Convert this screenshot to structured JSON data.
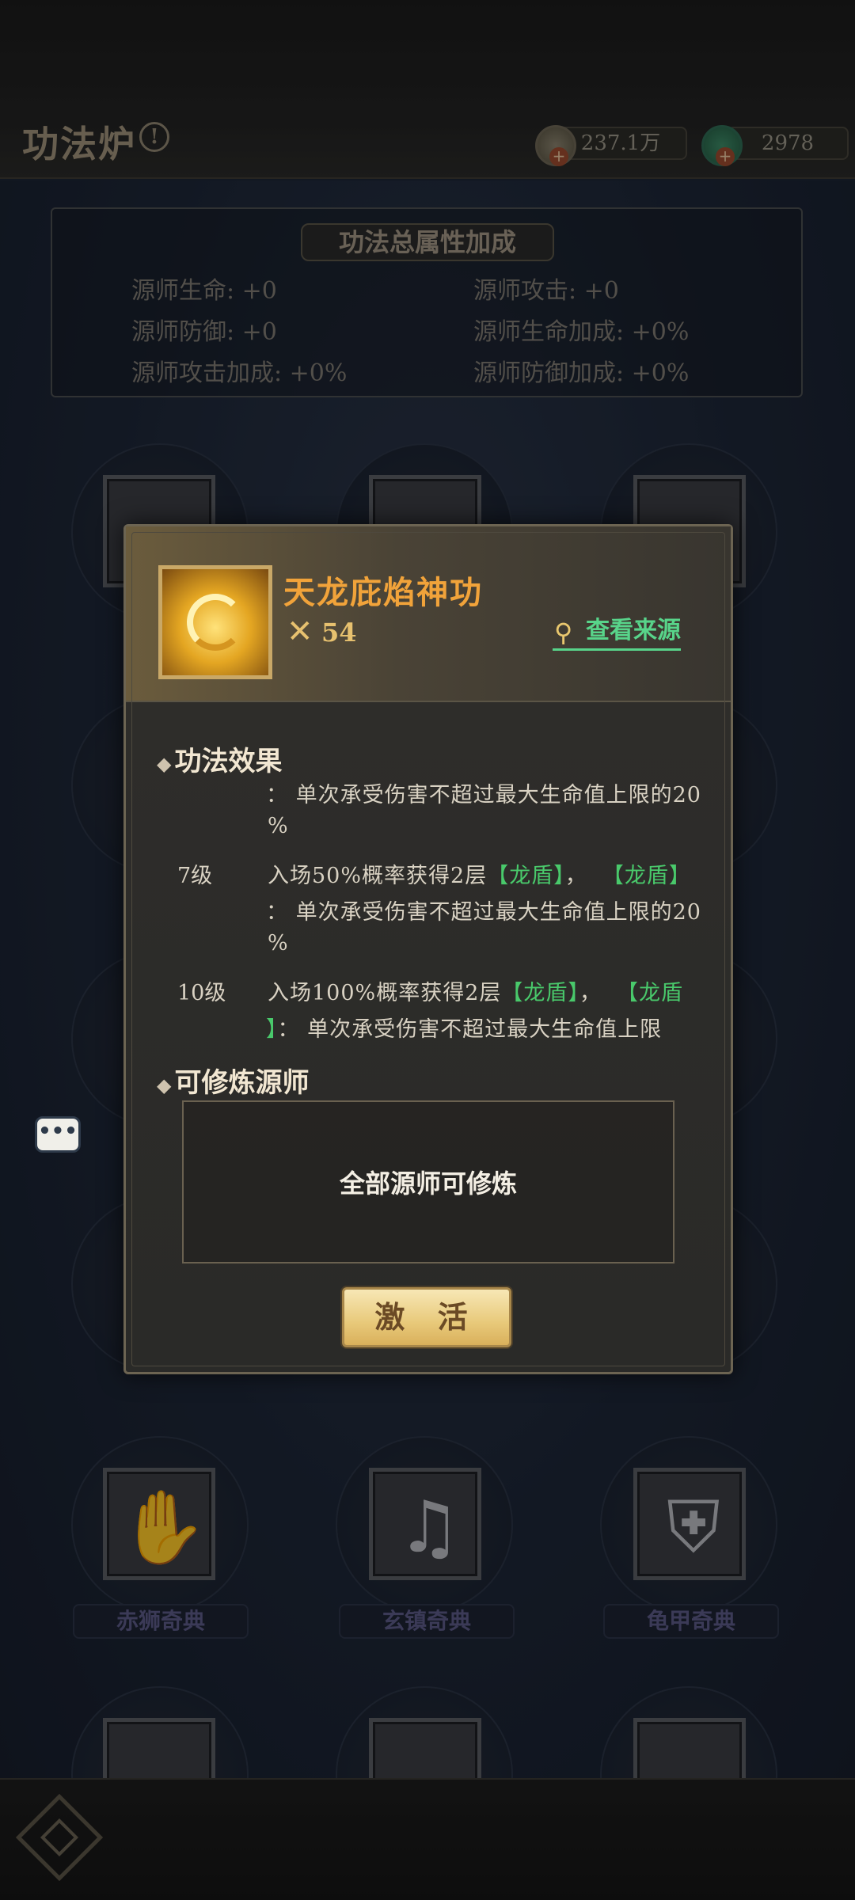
{
  "header": {
    "title": "功法炉",
    "info_icon": "!",
    "currency_coin": "237.1万",
    "currency_jade": "2978"
  },
  "stats": {
    "title": "功法总属性加成",
    "items": [
      "源师生命: +0",
      "源师攻击: +0",
      "源师防御: +0",
      "源师生命加成: +0%",
      "源师攻击加成: +0%",
      "源师防御加成: +0%"
    ]
  },
  "skills_grid": {
    "row_a": [
      "赤狮奇典",
      "玄镇奇典",
      "龟甲奇典"
    ]
  },
  "modal": {
    "skill_name": "天龙庇焰神功",
    "level": "54",
    "view_source": "查看来源",
    "effect_title": "功法效果",
    "effect_lines": {
      "l1": "： 单次承受伤害不超过最大生命值上限的20",
      "l2": "%",
      "lv7_tag": "7级",
      "lv7_a1": "入场50%概率获得2层",
      "lv7_a2": "【龙盾】",
      "lv7_a3": "，",
      "lv7_a4": "【龙盾】",
      "lv7_b": "： 单次承受伤害不超过最大生命值上限的20",
      "lv7_c": "%",
      "lv10_tag": "10级",
      "lv10_a1": "入场100%概率获得2层",
      "lv10_a2": "【龙盾】",
      "lv10_a3": "，",
      "lv10_a4": "【龙盾",
      "lv10_b1": "】",
      "lv10_b2": "： 单次承受伤害不超过最大生命值上限"
    },
    "cultivators_title": "可修炼源师",
    "cultivators_text": "全部源师可修炼",
    "activate_label": "激 活"
  },
  "icons": {
    "info": "info-icon",
    "coin": "coin-icon",
    "jade": "jade-icon",
    "level": "crossed-swords-icon",
    "search": "magnifier-icon",
    "chat": "chat-bubble-icon",
    "home": "home-diamond-icon"
  }
}
